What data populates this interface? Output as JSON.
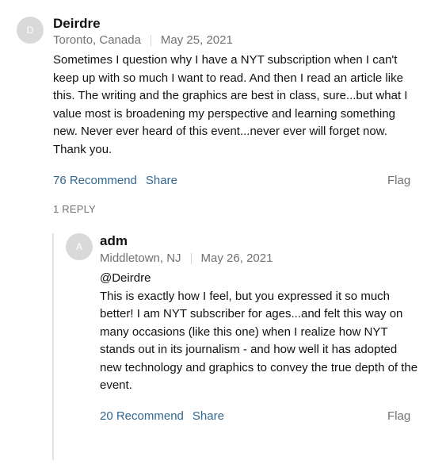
{
  "comment": {
    "avatar_initial": "D",
    "author": "Deirdre",
    "location": "Toronto, Canada",
    "date": "May 25, 2021",
    "body": "Sometimes I question why I have a NYT subscription when I can't keep up with so much I want to read.  And then I read an article like this.  The writing and the graphics are best in class, sure...but what I value most is broadening my perspective and learning something new.  Never ever heard of this event...never ever will forget now. Thank you.",
    "recommend_label": "76 Recommend",
    "share_label": "Share",
    "flag_label": "Flag"
  },
  "replies_label": "1 REPLY",
  "reply": {
    "avatar_initial": "A",
    "author": "adm",
    "location": "Middletown, NJ",
    "date": "May 26, 2021",
    "mention": "@Deirdre",
    "body": "This is exactly how I feel, but you expressed it so much better! I am NYT subscriber for ages...and felt this way on many occasions (like this one) when I realize how NYT stands out in its journalism - and how well it has adopted new technology and graphics to convey the true depth of the event.",
    "recommend_label": "20 Recommend",
    "share_label": "Share",
    "flag_label": "Flag"
  },
  "colors": {
    "link": "#326891",
    "muted": "#727272",
    "avatar": "#d9d9d9",
    "thread_line": "#e2e2e2"
  }
}
